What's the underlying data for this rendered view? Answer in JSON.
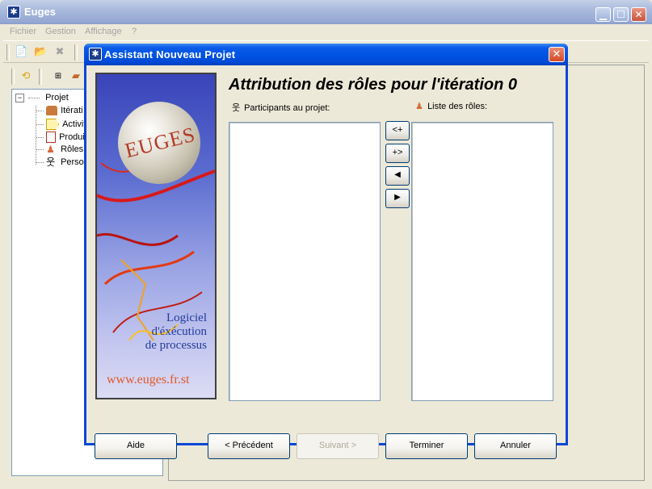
{
  "window": {
    "title": "Euges",
    "caption_buttons": [
      "minimize-icon",
      "maximize-icon",
      "close-icon"
    ]
  },
  "menu": {
    "items": [
      "Fichier",
      "Gestion",
      "Affichage",
      "?"
    ]
  },
  "tree": {
    "root": "Projet",
    "items": [
      {
        "label": "Itérati",
        "icon": "iteration-icon"
      },
      {
        "label": "Activit",
        "icon": "activity-icon"
      },
      {
        "label": "Produi",
        "icon": "product-icon"
      },
      {
        "label": "Rôles",
        "icon": "role-icon"
      },
      {
        "label": "Person",
        "icon": "person-icon"
      }
    ]
  },
  "dialog": {
    "title": "Assistant Nouveau Projet",
    "heading": "Attribution des rôles pour l'itération 0",
    "banner": {
      "logo_text": "EUGES",
      "lines": [
        "Logiciel",
        "d'éxécution",
        "de processus"
      ],
      "url": "www.euges.fr.st"
    },
    "participants_label": "Participants au projet:",
    "roles_label": "Liste des rôles:",
    "participants": [],
    "roles": [],
    "transfer_buttons": [
      "<+",
      "+>",
      "◀",
      "▶"
    ],
    "buttons": {
      "help": "Aide",
      "previous": "< Précédent",
      "next": "Suivant >",
      "finish": "Terminer",
      "cancel": "Annuler"
    },
    "next_enabled": false
  },
  "colors": {
    "dialog_titlebar": "#0054e3",
    "main_titlebar_inactive": "#a7b8dc",
    "window_bg": "#ece9d8",
    "disabled_text": "#aca899"
  }
}
